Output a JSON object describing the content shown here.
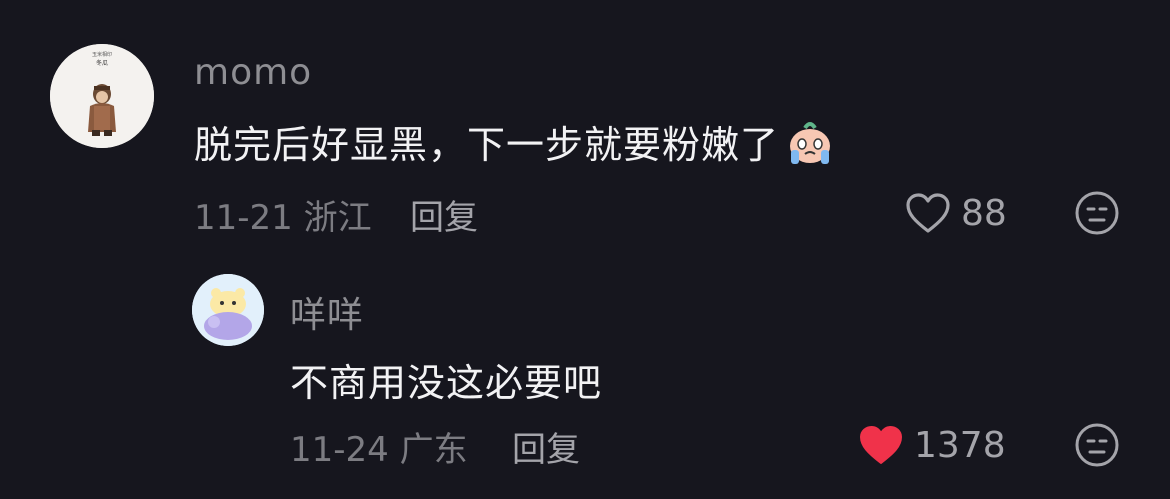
{
  "comments": [
    {
      "username": "momo",
      "avatar_text_top": "玉米相印",
      "avatar_text_name": "冬瓜",
      "text": "脱完后好显黑，下一步就要粉嫩了",
      "emoji": "crying-face-emoji",
      "date": "11-21",
      "location": "浙江",
      "reply_label": "回复",
      "like_count": "88",
      "liked": false,
      "icons": {
        "like": "heart-outline-icon",
        "dislike": "meh-face-icon"
      }
    },
    {
      "username": "咩咩",
      "text": "不商用没这必要吧",
      "date": "11-24",
      "location": "广东",
      "reply_label": "回复",
      "like_count": "1378",
      "liked": true,
      "like_color": "#f0324a",
      "icons": {
        "like": "heart-filled-icon",
        "dislike": "meh-face-icon"
      }
    }
  ]
}
